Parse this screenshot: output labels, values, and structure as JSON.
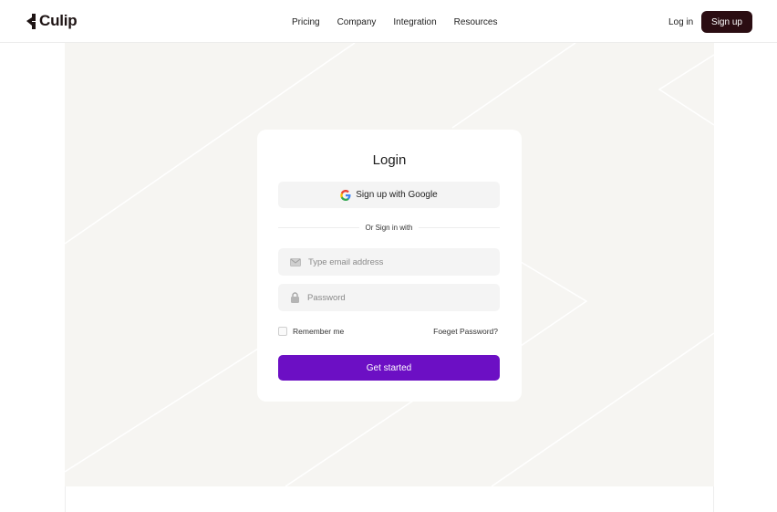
{
  "header": {
    "brand": "Culip",
    "nav": [
      {
        "label": "Pricing"
      },
      {
        "label": "Company"
      },
      {
        "label": "Integration"
      },
      {
        "label": "Resources"
      }
    ],
    "login_label": "Log in",
    "signup_label": "Sign up"
  },
  "login_card": {
    "title": "Login",
    "google_label": "Sign up with Google",
    "divider_text": "Or Sign in with",
    "email_placeholder": "Type email address",
    "password_placeholder": "Password",
    "remember_label": "Remember me",
    "forgot_label": "Foeget Password?",
    "submit_label": "Get started"
  },
  "colors": {
    "brand_dark": "#2b0d12",
    "accent": "#6c0fc4",
    "hero_bg": "#f6f5f2"
  }
}
